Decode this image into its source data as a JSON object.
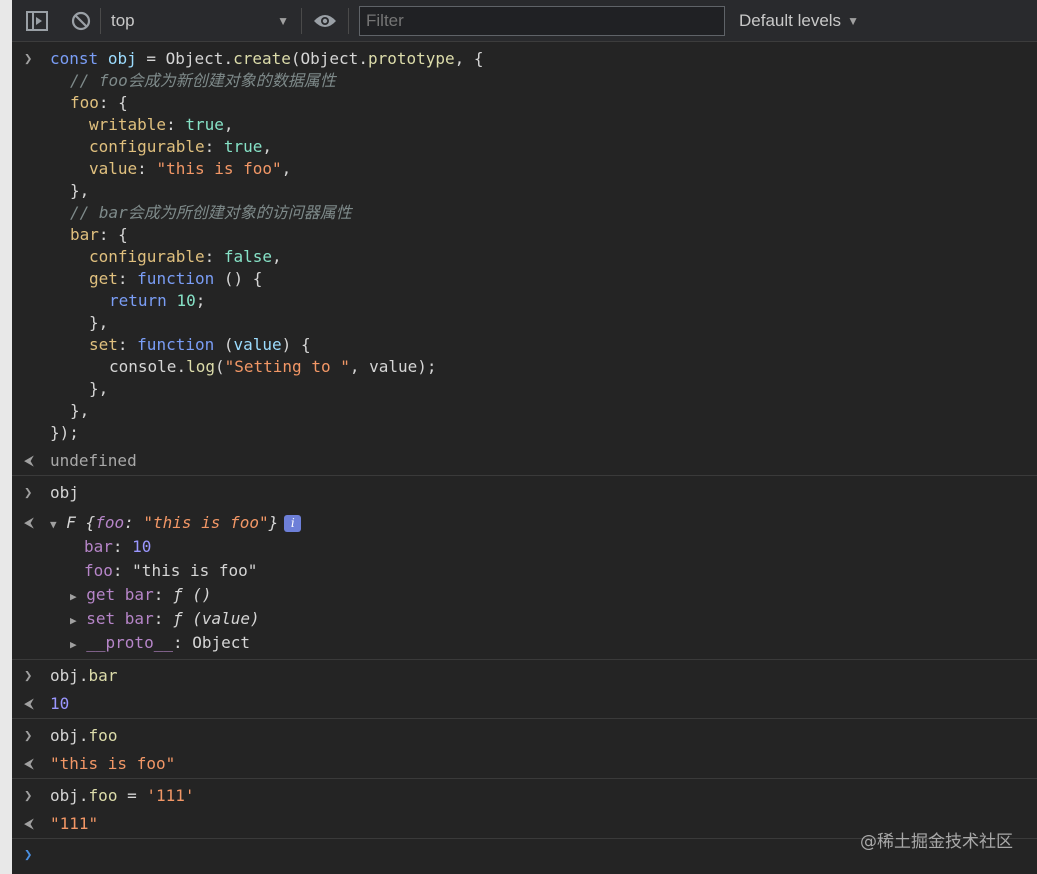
{
  "toolbar": {
    "context": "top",
    "filter_placeholder": "Filter",
    "levels": "Default levels"
  },
  "code_input": {
    "line1": [
      "const",
      "obj",
      "=",
      "Object",
      ".",
      "create",
      "(",
      "Object",
      ".",
      "prototype",
      ", {"
    ],
    "comment1": "// foo会成为新创建对象的数据属性",
    "comment2": "// bar会成为所创建对象的访问器属性",
    "foo_key": "foo",
    "bar_key": "bar",
    "writable_key": "writable",
    "configurable_key": "configurable",
    "value_key": "value",
    "get_key": "get",
    "set_key": "set",
    "true_val": "true",
    "false_val": "false",
    "str_foo": "\"this is foo\"",
    "function_kw": "function",
    "return_kw": "return",
    "ten": "10",
    "value_param": "value",
    "console": "console",
    "log": "log",
    "str_setting": "\"Setting to \"",
    "close": "});"
  },
  "outputs": {
    "undefined": "undefined",
    "obj_cmd": "obj",
    "obj_summary_prefix": "F",
    "obj_summary": "{foo: \"this is foo\"}",
    "info_icon": "i",
    "prop_bar": "bar",
    "prop_bar_val": "10",
    "prop_foo": "foo",
    "prop_foo_val": "\"this is foo\"",
    "get_bar": "get bar",
    "get_bar_val": "ƒ ()",
    "set_bar": "set bar",
    "set_bar_val": "ƒ (value)",
    "proto": "__proto__",
    "proto_val": "Object",
    "cmd_bar_obj": "obj",
    "cmd_bar_prop": "bar",
    "res_bar": "10",
    "cmd_foo_obj": "obj",
    "cmd_foo_prop": "foo",
    "res_foo": "\"this is foo\"",
    "cmd_assign_obj": "obj",
    "cmd_assign_prop": "foo",
    "cmd_assign_str": "'111'",
    "res_assign": "\"111\""
  },
  "watermark": "@稀土掘金技术社区"
}
